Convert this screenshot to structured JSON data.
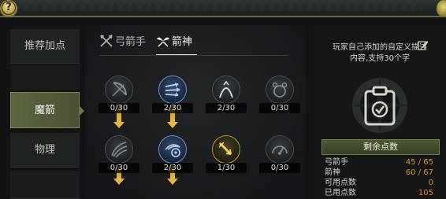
{
  "window": {
    "help_label": "?"
  },
  "sidebar": {
    "items": [
      {
        "label": "推荐加点",
        "active": false
      },
      {
        "label": "魔箭",
        "active": true
      },
      {
        "label": "物理",
        "active": false
      },
      {
        "label": "",
        "active": false
      }
    ]
  },
  "tabs": [
    {
      "label": "弓箭手",
      "icon": "crossed-arrows-icon",
      "active": false
    },
    {
      "label": "箭神",
      "icon": "twin-wings-icon",
      "active": true
    }
  ],
  "skills": [
    {
      "count": "0/30",
      "icon": "bow-icon",
      "style": "dim"
    },
    {
      "count": "2/30",
      "icon": "multi-arrow-icon",
      "style": "lit"
    },
    {
      "count": "2/30",
      "icon": "arc-up-icon",
      "style": "dim"
    },
    {
      "count": "0/30",
      "icon": "bear-icon",
      "style": "dim"
    },
    {
      "count": "0/30",
      "icon": "wind-slash-icon",
      "style": "dim"
    },
    {
      "count": "2/30",
      "icon": "target-swirl-icon",
      "style": "lit"
    },
    {
      "count": "1/30",
      "icon": "golden-arrow-icon",
      "style": "gold"
    },
    {
      "count": "0/30",
      "icon": "gauge-icon",
      "style": "dim"
    }
  ],
  "right_panel": {
    "description": "玩家自己添加的自定义描述内容,支持30个字",
    "remaining_title": "剩余点数",
    "stats": [
      {
        "label": "弓箭手",
        "value": "45 / 65"
      },
      {
        "label": "箭神",
        "value": "60 / 67"
      },
      {
        "label": "可用点数",
        "value": "0"
      },
      {
        "label": "已用点数",
        "value": "105"
      }
    ]
  },
  "colors": {
    "accent_gold": "#e6b640",
    "value_orange": "#d9902e",
    "panel_green": "#4d5a34"
  }
}
